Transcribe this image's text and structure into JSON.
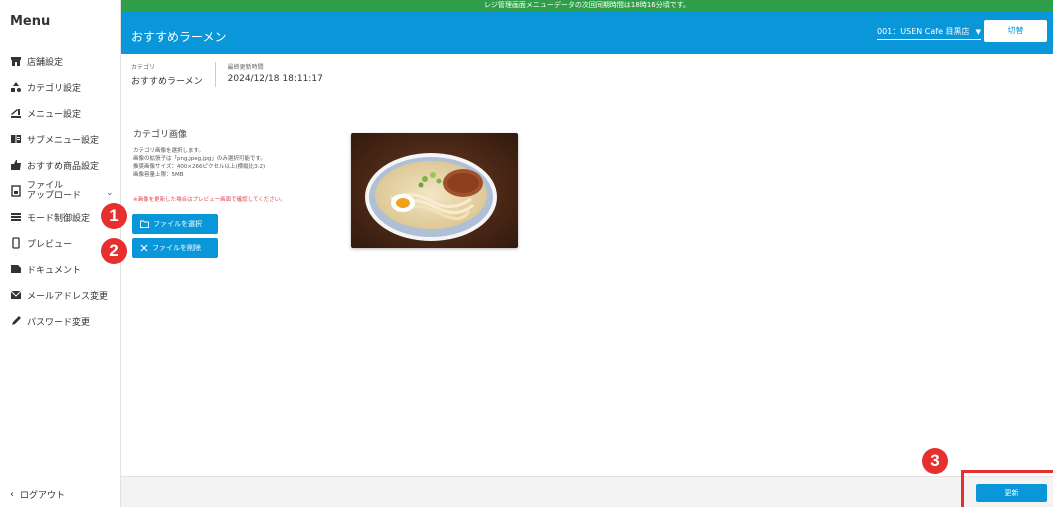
{
  "sidebar": {
    "title": "Menu",
    "items": [
      {
        "label": "店舗設定",
        "icon": "store-icon"
      },
      {
        "label": "カテゴリ設定",
        "icon": "category-icon"
      },
      {
        "label": "メニュー設定",
        "icon": "menu-icon"
      },
      {
        "label": "サブメニュー設定",
        "icon": "submenu-icon"
      },
      {
        "label": "おすすめ商品設定",
        "icon": "thumbs-up-icon"
      },
      {
        "label": "ファイル\nアップロード",
        "icon": "file-upload-icon"
      },
      {
        "label": "モード制御設定",
        "icon": "list-icon"
      },
      {
        "label": "プレビュー",
        "icon": "phone-icon"
      },
      {
        "label": "ドキュメント",
        "icon": "document-icon"
      },
      {
        "label": "メールアドレス変更",
        "icon": "mail-icon"
      },
      {
        "label": "パスワード変更",
        "icon": "pencil-icon"
      }
    ],
    "logout": "ログアウト"
  },
  "notice": "レジ管理画面メニューデータの次回同期時間は18時16分頃です。",
  "header": {
    "title": "おすすめラーメン",
    "store": "001：USEN Cafe 目黒店",
    "switch_label": "切替"
  },
  "info": {
    "category_label": "カテゴリ",
    "category_value": "おすすめラーメン",
    "updated_label": "最終更新時間",
    "updated_value": "2024/12/18 18:11:17"
  },
  "image_section": {
    "label": "カテゴリ画像",
    "desc_lines": [
      "カテゴリ画像を選択します。",
      "画像の拡張子は「png,jpeg,jpg」のみ選択可能です。",
      "推奨画像サイズ：400×266ピクセル以上(横縦比3:2)",
      "画像容量上限：5MB"
    ],
    "warning": "※画像を更新した場合はプレビュー画面で確認してください。",
    "select_label": "ファイルを選択",
    "delete_label": "ファイルを削除"
  },
  "badges": [
    "1",
    "2",
    "3"
  ],
  "footer": {
    "update_label": "更新"
  },
  "colors": {
    "primary": "#0a97d9",
    "notice_green": "#2f9e4a",
    "annotation_red": "#e63030"
  }
}
